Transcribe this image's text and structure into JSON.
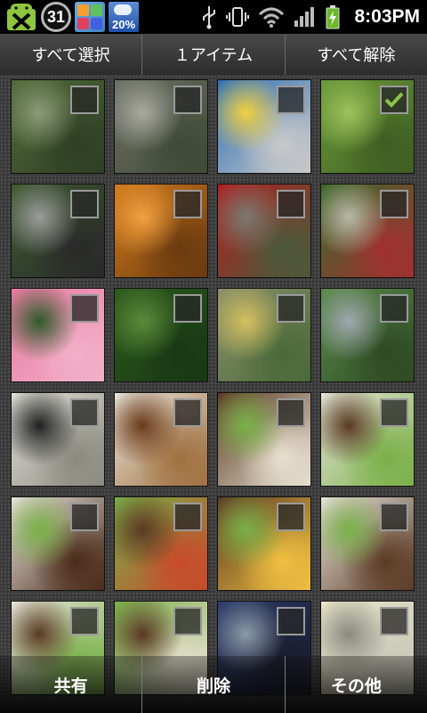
{
  "status_bar": {
    "calendar_day": "31",
    "weather_percent": "20%",
    "time": "8:03PM",
    "icons": [
      "android-debug-icon",
      "calendar-icon",
      "app-tile-icon",
      "weather-icon",
      "usb-icon",
      "vibrate-icon",
      "wifi-icon",
      "signal-icon",
      "battery-charging-icon"
    ]
  },
  "action_bar": {
    "select_all": "すべて選択",
    "count": "１アイテム",
    "deselect_all": "すべて解除"
  },
  "grid": {
    "thumbnails": [
      {
        "subject": "potted-plants",
        "checked": false,
        "colors": [
          "#4f6a3a",
          "#8c9a78",
          "#2f3f24"
        ]
      },
      {
        "subject": "fountain",
        "checked": false,
        "colors": [
          "#6d7065",
          "#a9a9a0",
          "#3f4a35"
        ]
      },
      {
        "subject": "penguin-slide",
        "checked": false,
        "colors": [
          "#2e6fb4",
          "#f0d040",
          "#c9c9c9"
        ]
      },
      {
        "subject": "green-leaves",
        "checked": true,
        "colors": [
          "#6c9a3a",
          "#9cc25a",
          "#3e5e22"
        ]
      },
      {
        "subject": "chains",
        "checked": false,
        "colors": [
          "#3d5a2e",
          "#9b9b9b",
          "#2a2a2a"
        ]
      },
      {
        "subject": "orange-slide",
        "checked": false,
        "colors": [
          "#d07a1a",
          "#f0a040",
          "#6a3a10"
        ]
      },
      {
        "subject": "swing-red",
        "checked": false,
        "colors": [
          "#b02020",
          "#7a7a70",
          "#4a5a3a"
        ]
      },
      {
        "subject": "swing-set",
        "checked": false,
        "colors": [
          "#3a6a2a",
          "#b8b8a8",
          "#a03030"
        ]
      },
      {
        "subject": "pink-flower",
        "checked": false,
        "colors": [
          "#e87aa0",
          "#2f5a2a",
          "#f2b0c8"
        ]
      },
      {
        "subject": "pine-branch",
        "checked": false,
        "colors": [
          "#2c5a1c",
          "#5c8a3a",
          "#183814"
        ]
      },
      {
        "subject": "train",
        "checked": false,
        "colors": [
          "#8a8f6a",
          "#d4c060",
          "#4a6a3a"
        ]
      },
      {
        "subject": "city-trees",
        "checked": false,
        "colors": [
          "#5a8a4a",
          "#a0a8b0",
          "#2e4a24"
        ]
      },
      {
        "subject": "lanterns",
        "checked": false,
        "colors": [
          "#e0e0d8",
          "#202020",
          "#8a8a80"
        ]
      },
      {
        "subject": "soup",
        "checked": false,
        "colors": [
          "#e8e4dc",
          "#6a3a18",
          "#a07040"
        ]
      },
      {
        "subject": "dish-asparagus",
        "checked": false,
        "colors": [
          "#5a3a24",
          "#7ab048",
          "#e8e0d0"
        ]
      },
      {
        "subject": "dish-plate",
        "checked": false,
        "colors": [
          "#e8e4dc",
          "#5a3a24",
          "#7ab048"
        ]
      },
      {
        "subject": "dish-closeup",
        "checked": false,
        "colors": [
          "#e8e4dc",
          "#7ab048",
          "#4a2a18"
        ]
      },
      {
        "subject": "dish-asparagus-2",
        "checked": false,
        "colors": [
          "#7ab048",
          "#5a3a24",
          "#c84a2a"
        ]
      },
      {
        "subject": "dish-asparagus-3",
        "checked": false,
        "colors": [
          "#5a3a24",
          "#7ab048",
          "#f0c040"
        ]
      },
      {
        "subject": "dish-plate-2",
        "checked": false,
        "colors": [
          "#e8e4dc",
          "#7ab048",
          "#5a3a24"
        ]
      },
      {
        "subject": "dish-plate-3",
        "checked": false,
        "colors": [
          "#e8e4dc",
          "#5a3a24",
          "#7ab048"
        ]
      },
      {
        "subject": "dish-asparagus-4",
        "checked": false,
        "colors": [
          "#7ab048",
          "#5a3a24",
          "#e8e0d0"
        ]
      },
      {
        "subject": "office-blue",
        "checked": false,
        "colors": [
          "#2a3a6a",
          "#8a9aa8",
          "#1a1a2a"
        ]
      },
      {
        "subject": "office-light",
        "checked": false,
        "colors": [
          "#e8e4c8",
          "#8a8a80",
          "#c8c8b8"
        ]
      }
    ]
  },
  "bottom_bar": {
    "share": "共有",
    "delete": "削除",
    "more": "その他"
  },
  "colors": {
    "check_accent": "#8bc34a",
    "action_bar": "#3a3a3a"
  }
}
